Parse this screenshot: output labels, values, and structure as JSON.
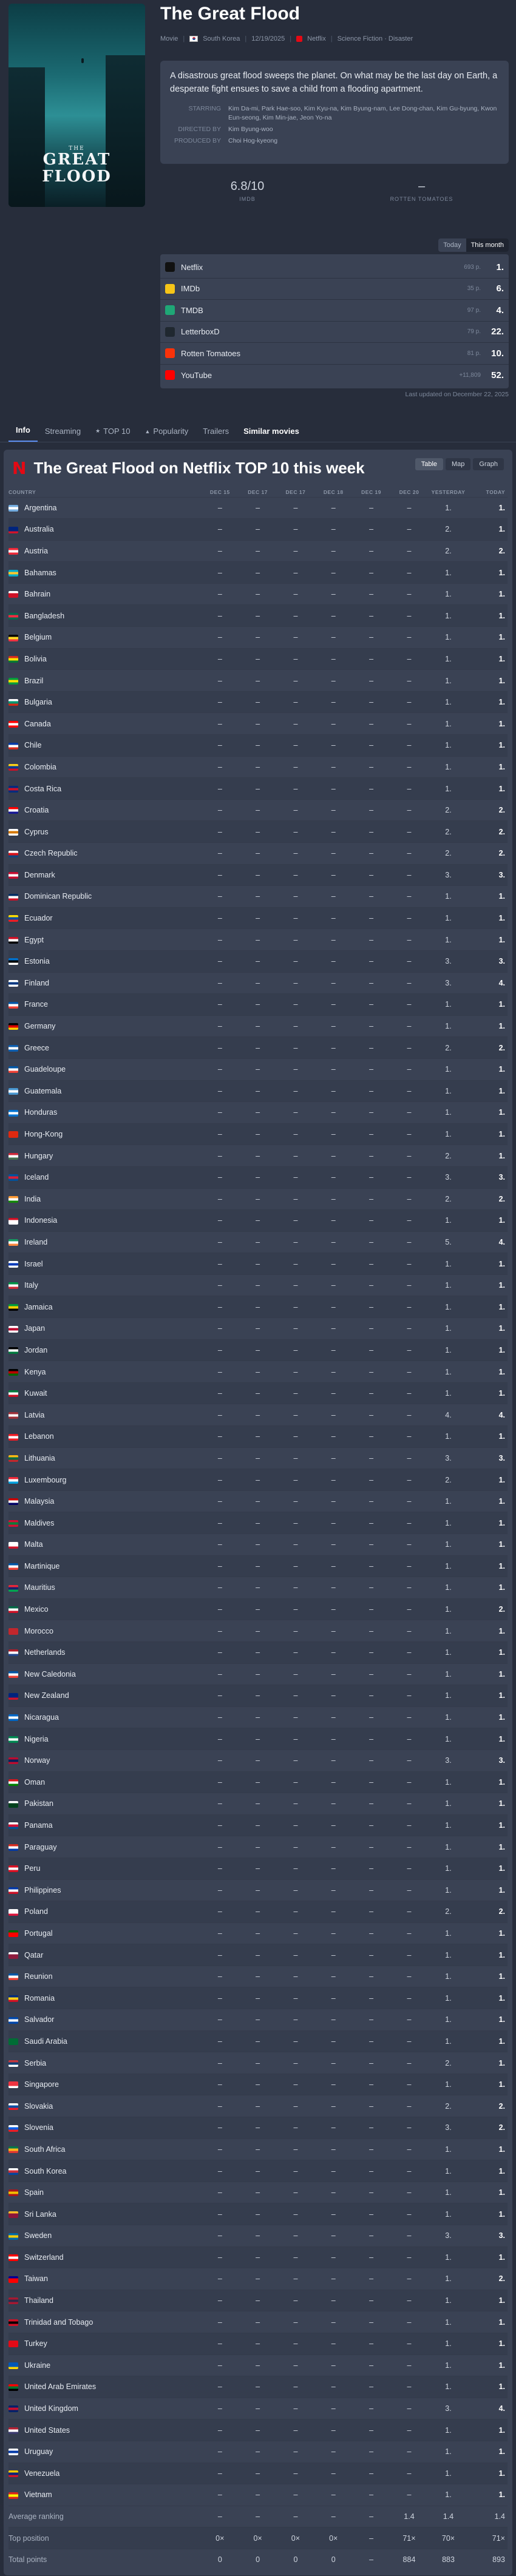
{
  "title": "The Great Flood",
  "meta": {
    "type": "Movie",
    "country": "South Korea",
    "date": "12/19/2025",
    "platform": "Netflix",
    "genres": "Science Fiction · Disaster"
  },
  "poster": {
    "title_line1": "THE",
    "title_line2": "GREAT FLOOD"
  },
  "description": "A disastrous great flood sweeps the planet. On what may be the last day on Earth, a desperate fight ensues to save a child from a flooding apartment.",
  "crew": [
    {
      "label": "STARRING",
      "value": "Kim Da-mi, Park Hae-soo, Kim Kyu-na, Kim Byung-nam, Lee Dong-chan, Kim Gu-byung, Kwon Eun-seong, Kim Min-jae, Jeon Yo-na"
    },
    {
      "label": "DIRECTED BY",
      "value": "Kim Byung-woo"
    },
    {
      "label": "PRODUCED BY",
      "value": "Choi Hog-kyeong"
    }
  ],
  "scores": [
    {
      "value": "6.8/10",
      "label": "IMDB"
    },
    {
      "value": "–",
      "label": "ROTTEN TOMATOES"
    }
  ],
  "period_toggle": {
    "today": "Today",
    "this_month": "This month"
  },
  "rankings": [
    {
      "name": "Netflix",
      "change": "693 p.",
      "position": "1.",
      "icon": "netflix-icon",
      "color": "#111111"
    },
    {
      "name": "IMDb",
      "change": "35 p.",
      "position": "6.",
      "icon": "imdb-icon",
      "color": "#f5c518"
    },
    {
      "name": "TMDB",
      "change": "97 p.",
      "position": "4.",
      "icon": "tmdb-icon",
      "color": "#1fa776"
    },
    {
      "name": "LetterboxD",
      "change": "79 p.",
      "position": "22.",
      "icon": "letterboxd-icon",
      "color": "#202830"
    },
    {
      "name": "Rotten Tomatoes",
      "change": "81 p.",
      "position": "10.",
      "icon": "tomato-icon",
      "color": "#fa320a"
    },
    {
      "name": "YouTube",
      "change": "+11,809",
      "position": "52.",
      "icon": "youtube-icon",
      "color": "#ff0000"
    }
  ],
  "last_updated": "Last updated on December 22, 2025",
  "tabs": [
    {
      "label": "Info",
      "active": true
    },
    {
      "label": "Streaming"
    },
    {
      "label": "TOP 10"
    },
    {
      "label": "Popularity"
    },
    {
      "label": "Trailers"
    },
    {
      "label": "Similar movies"
    }
  ],
  "section": {
    "title": "The Great Flood on Netflix TOP 10 this week",
    "views": [
      "Table",
      "Map",
      "Graph"
    ],
    "columns": [
      "COUNTRY",
      "DEC 15",
      "DEC 17",
      "DEC 17",
      "DEC 18",
      "DEC 19",
      "DEC 20",
      "YESTERDAY",
      "TODAY"
    ]
  },
  "countries": [
    {
      "name": "Argentina",
      "flag": [
        "#74acdf",
        "#ffffff",
        "#74acdf"
      ],
      "y": "1.",
      "t": "1."
    },
    {
      "name": "Australia",
      "flag": [
        "#00247d",
        "#00247d",
        "#cf142b"
      ],
      "y": "2.",
      "t": "1."
    },
    {
      "name": "Austria",
      "flag": [
        "#ed2939",
        "#ffffff",
        "#ed2939"
      ],
      "y": "2.",
      "t": "2."
    },
    {
      "name": "Bahamas",
      "flag": [
        "#00abc9",
        "#ffc72c",
        "#00abc9"
      ],
      "y": "1.",
      "t": "1."
    },
    {
      "name": "Bahrain",
      "flag": [
        "#ffffff",
        "#ce1126",
        "#ce1126"
      ],
      "y": "1.",
      "t": "1."
    },
    {
      "name": "Bangladesh",
      "flag": [
        "#006a4e",
        "#f42a41",
        "#006a4e"
      ],
      "y": "1.",
      "t": "1."
    },
    {
      "name": "Belgium",
      "flag": [
        "#000000",
        "#fdda24",
        "#ef3340"
      ],
      "y": "1.",
      "t": "1."
    },
    {
      "name": "Bolivia",
      "flag": [
        "#d52b1e",
        "#f9e300",
        "#007934"
      ],
      "y": "1.",
      "t": "1."
    },
    {
      "name": "Brazil",
      "flag": [
        "#009c3b",
        "#ffdf00",
        "#009c3b"
      ],
      "y": "1.",
      "t": "1."
    },
    {
      "name": "Bulgaria",
      "flag": [
        "#ffffff",
        "#00966e",
        "#d62612"
      ],
      "y": "1.",
      "t": "1."
    },
    {
      "name": "Canada",
      "flag": [
        "#ff0000",
        "#ffffff",
        "#ff0000"
      ],
      "y": "1.",
      "t": "1."
    },
    {
      "name": "Chile",
      "flag": [
        "#0039a6",
        "#ffffff",
        "#d52b1e"
      ],
      "y": "1.",
      "t": "1."
    },
    {
      "name": "Colombia",
      "flag": [
        "#fcd116",
        "#003893",
        "#ce1126"
      ],
      "y": "1.",
      "t": "1."
    },
    {
      "name": "Costa Rica",
      "flag": [
        "#002b7f",
        "#ce1126",
        "#002b7f"
      ],
      "y": "1.",
      "t": "1."
    },
    {
      "name": "Croatia",
      "flag": [
        "#ff0000",
        "#ffffff",
        "#171796"
      ],
      "y": "2.",
      "t": "2."
    },
    {
      "name": "Cyprus",
      "flag": [
        "#ffffff",
        "#d57800",
        "#ffffff"
      ],
      "y": "2.",
      "t": "2."
    },
    {
      "name": "Czech Republic",
      "flag": [
        "#ffffff",
        "#d7141a",
        "#11457e"
      ],
      "y": "2.",
      "t": "2."
    },
    {
      "name": "Denmark",
      "flag": [
        "#c60c30",
        "#ffffff",
        "#c60c30"
      ],
      "y": "3.",
      "t": "3."
    },
    {
      "name": "Dominican Republic",
      "flag": [
        "#002d62",
        "#ffffff",
        "#ce1126"
      ],
      "y": "1.",
      "t": "1."
    },
    {
      "name": "Ecuador",
      "flag": [
        "#ffdd00",
        "#034ea2",
        "#ed1c24"
      ],
      "y": "1.",
      "t": "1."
    },
    {
      "name": "Egypt",
      "flag": [
        "#ce1126",
        "#ffffff",
        "#000000"
      ],
      "y": "1.",
      "t": "1."
    },
    {
      "name": "Estonia",
      "flag": [
        "#0072ce",
        "#000000",
        "#ffffff"
      ],
      "y": "3.",
      "t": "3."
    },
    {
      "name": "Finland",
      "flag": [
        "#ffffff",
        "#003580",
        "#ffffff"
      ],
      "y": "3.",
      "t": "4."
    },
    {
      "name": "France",
      "flag": [
        "#0055a4",
        "#ffffff",
        "#ef4135"
      ],
      "y": "1.",
      "t": "1."
    },
    {
      "name": "Germany",
      "flag": [
        "#000000",
        "#dd0000",
        "#ffce00"
      ],
      "y": "1.",
      "t": "1."
    },
    {
      "name": "Greece",
      "flag": [
        "#0d5eaf",
        "#ffffff",
        "#0d5eaf"
      ],
      "y": "2.",
      "t": "2."
    },
    {
      "name": "Guadeloupe",
      "flag": [
        "#0055a4",
        "#ffffff",
        "#ef4135"
      ],
      "y": "1.",
      "t": "1."
    },
    {
      "name": "Guatemala",
      "flag": [
        "#4997d0",
        "#ffffff",
        "#4997d0"
      ],
      "y": "1.",
      "t": "1."
    },
    {
      "name": "Honduras",
      "flag": [
        "#0073cf",
        "#ffffff",
        "#0073cf"
      ],
      "y": "1.",
      "t": "1."
    },
    {
      "name": "Hong-Kong",
      "flag": [
        "#de2910",
        "#de2910",
        "#de2910"
      ],
      "y": "1.",
      "t": "1."
    },
    {
      "name": "Hungary",
      "flag": [
        "#ce2939",
        "#ffffff",
        "#477050"
      ],
      "y": "2.",
      "t": "1."
    },
    {
      "name": "Iceland",
      "flag": [
        "#02529c",
        "#dc1e35",
        "#02529c"
      ],
      "y": "3.",
      "t": "3."
    },
    {
      "name": "India",
      "flag": [
        "#ff9933",
        "#ffffff",
        "#138808"
      ],
      "y": "2.",
      "t": "2."
    },
    {
      "name": "Indonesia",
      "flag": [
        "#ce1126",
        "#ffffff",
        "#ffffff"
      ],
      "y": "1.",
      "t": "1."
    },
    {
      "name": "Ireland",
      "flag": [
        "#169b62",
        "#ffffff",
        "#ff883e"
      ],
      "y": "5.",
      "t": "4."
    },
    {
      "name": "Israel",
      "flag": [
        "#ffffff",
        "#0038b8",
        "#ffffff"
      ],
      "y": "1.",
      "t": "1."
    },
    {
      "name": "Italy",
      "flag": [
        "#009246",
        "#ffffff",
        "#ce2b37"
      ],
      "y": "1.",
      "t": "1."
    },
    {
      "name": "Jamaica",
      "flag": [
        "#009b3a",
        "#fed100",
        "#000000"
      ],
      "y": "1.",
      "t": "1."
    },
    {
      "name": "Japan",
      "flag": [
        "#ffffff",
        "#bc002d",
        "#ffffff"
      ],
      "y": "1.",
      "t": "1."
    },
    {
      "name": "Jordan",
      "flag": [
        "#000000",
        "#ffffff",
        "#007a3d"
      ],
      "y": "1.",
      "t": "1."
    },
    {
      "name": "Kenya",
      "flag": [
        "#000000",
        "#bb0000",
        "#006600"
      ],
      "y": "1.",
      "t": "1."
    },
    {
      "name": "Kuwait",
      "flag": [
        "#007a3d",
        "#ffffff",
        "#ce1126"
      ],
      "y": "1.",
      "t": "1."
    },
    {
      "name": "Latvia",
      "flag": [
        "#9e3039",
        "#ffffff",
        "#9e3039"
      ],
      "y": "4.",
      "t": "4."
    },
    {
      "name": "Lebanon",
      "flag": [
        "#ed1c24",
        "#ffffff",
        "#ed1c24"
      ],
      "y": "1.",
      "t": "1."
    },
    {
      "name": "Lithuania",
      "flag": [
        "#fdb913",
        "#006a44",
        "#c1272d"
      ],
      "y": "3.",
      "t": "3."
    },
    {
      "name": "Luxembourg",
      "flag": [
        "#ed2939",
        "#ffffff",
        "#00a1de"
      ],
      "y": "2.",
      "t": "1."
    },
    {
      "name": "Malaysia",
      "flag": [
        "#cc0001",
        "#ffffff",
        "#010066"
      ],
      "y": "1.",
      "t": "1."
    },
    {
      "name": "Maldives",
      "flag": [
        "#d21034",
        "#007e3a",
        "#d21034"
      ],
      "y": "1.",
      "t": "1."
    },
    {
      "name": "Malta",
      "flag": [
        "#ffffff",
        "#ffffff",
        "#cf142b"
      ],
      "y": "1.",
      "t": "1."
    },
    {
      "name": "Martinique",
      "flag": [
        "#0055a4",
        "#ffffff",
        "#ef4135"
      ],
      "y": "1.",
      "t": "1."
    },
    {
      "name": "Mauritius",
      "flag": [
        "#ea2839",
        "#1a206d",
        "#00a551"
      ],
      "y": "1.",
      "t": "1."
    },
    {
      "name": "Mexico",
      "flag": [
        "#006847",
        "#ffffff",
        "#ce1126"
      ],
      "y": "1.",
      "t": "2."
    },
    {
      "name": "Morocco",
      "flag": [
        "#c1272d",
        "#c1272d",
        "#c1272d"
      ],
      "y": "1.",
      "t": "1."
    },
    {
      "name": "Netherlands",
      "flag": [
        "#ae1c28",
        "#ffffff",
        "#21468b"
      ],
      "y": "1.",
      "t": "1."
    },
    {
      "name": "New Caledonia",
      "flag": [
        "#0055a4",
        "#ffffff",
        "#ef4135"
      ],
      "y": "1.",
      "t": "1."
    },
    {
      "name": "New Zealand",
      "flag": [
        "#00247d",
        "#00247d",
        "#cc142b"
      ],
      "y": "1.",
      "t": "1."
    },
    {
      "name": "Nicaragua",
      "flag": [
        "#0067c6",
        "#ffffff",
        "#0067c6"
      ],
      "y": "1.",
      "t": "1."
    },
    {
      "name": "Nigeria",
      "flag": [
        "#008751",
        "#ffffff",
        "#008751"
      ],
      "y": "1.",
      "t": "1."
    },
    {
      "name": "Norway",
      "flag": [
        "#ba0c2f",
        "#00205b",
        "#ba0c2f"
      ],
      "y": "3.",
      "t": "3."
    },
    {
      "name": "Oman",
      "flag": [
        "#db161b",
        "#ffffff",
        "#008000"
      ],
      "y": "1.",
      "t": "1."
    },
    {
      "name": "Pakistan",
      "flag": [
        "#ffffff",
        "#01411c",
        "#01411c"
      ],
      "y": "1.",
      "t": "1."
    },
    {
      "name": "Panama",
      "flag": [
        "#ffffff",
        "#d21034",
        "#005293"
      ],
      "y": "1.",
      "t": "1."
    },
    {
      "name": "Paraguay",
      "flag": [
        "#d52b1e",
        "#ffffff",
        "#0038a8"
      ],
      "y": "1.",
      "t": "1."
    },
    {
      "name": "Peru",
      "flag": [
        "#d91023",
        "#ffffff",
        "#d91023"
      ],
      "y": "1.",
      "t": "1."
    },
    {
      "name": "Philippines",
      "flag": [
        "#0038a8",
        "#ffffff",
        "#ce1126"
      ],
      "y": "1.",
      "t": "1."
    },
    {
      "name": "Poland",
      "flag": [
        "#ffffff",
        "#ffffff",
        "#dc143c"
      ],
      "y": "2.",
      "t": "2."
    },
    {
      "name": "Portugal",
      "flag": [
        "#006600",
        "#ff0000",
        "#ff0000"
      ],
      "y": "1.",
      "t": "1."
    },
    {
      "name": "Qatar",
      "flag": [
        "#ffffff",
        "#8d1b3d",
        "#8d1b3d"
      ],
      "y": "1.",
      "t": "1."
    },
    {
      "name": "Reunion",
      "flag": [
        "#0055a4",
        "#ffffff",
        "#ef4135"
      ],
      "y": "1.",
      "t": "1."
    },
    {
      "name": "Romania",
      "flag": [
        "#002b7f",
        "#fcd116",
        "#ce1126"
      ],
      "y": "1.",
      "t": "1."
    },
    {
      "name": "Salvador",
      "flag": [
        "#0047ab",
        "#ffffff",
        "#0047ab"
      ],
      "y": "1.",
      "t": "1."
    },
    {
      "name": "Saudi Arabia",
      "flag": [
        "#006c35",
        "#006c35",
        "#006c35"
      ],
      "y": "1.",
      "t": "1."
    },
    {
      "name": "Serbia",
      "flag": [
        "#c6363c",
        "#0c4076",
        "#ffffff"
      ],
      "y": "2.",
      "t": "1."
    },
    {
      "name": "Singapore",
      "flag": [
        "#ef3340",
        "#ef3340",
        "#ffffff"
      ],
      "y": "1.",
      "t": "1."
    },
    {
      "name": "Slovakia",
      "flag": [
        "#ffffff",
        "#0b4ea2",
        "#ee1c25"
      ],
      "y": "2.",
      "t": "2."
    },
    {
      "name": "Slovenia",
      "flag": [
        "#ffffff",
        "#005ce5",
        "#ed1c24"
      ],
      "y": "3.",
      "t": "2."
    },
    {
      "name": "South Africa",
      "flag": [
        "#007749",
        "#ffb81c",
        "#de3831"
      ],
      "y": "1.",
      "t": "1."
    },
    {
      "name": "South Korea",
      "flag": [
        "#ffffff",
        "#cd2e3a",
        "#0047a0"
      ],
      "y": "1.",
      "t": "1."
    },
    {
      "name": "Spain",
      "flag": [
        "#aa151b",
        "#f1bf00",
        "#aa151b"
      ],
      "y": "1.",
      "t": "1."
    },
    {
      "name": "Sri Lanka",
      "flag": [
        "#ffbe29",
        "#8d153a",
        "#8d153a"
      ],
      "y": "1.",
      "t": "1."
    },
    {
      "name": "Sweden",
      "flag": [
        "#006aa7",
        "#fecc00",
        "#006aa7"
      ],
      "y": "3.",
      "t": "3."
    },
    {
      "name": "Switzerland",
      "flag": [
        "#ff0000",
        "#ffffff",
        "#ff0000"
      ],
      "y": "1.",
      "t": "1."
    },
    {
      "name": "Taiwan",
      "flag": [
        "#000095",
        "#fe0000",
        "#fe0000"
      ],
      "y": "1.",
      "t": "2."
    },
    {
      "name": "Thailand",
      "flag": [
        "#a51931",
        "#2d2a4a",
        "#a51931"
      ],
      "y": "1.",
      "t": "1."
    },
    {
      "name": "Trinidad and Tobago",
      "flag": [
        "#ce1126",
        "#000000",
        "#ce1126"
      ],
      "y": "1.",
      "t": "1."
    },
    {
      "name": "Turkey",
      "flag": [
        "#e30a17",
        "#e30a17",
        "#e30a17"
      ],
      "y": "1.",
      "t": "1."
    },
    {
      "name": "Ukraine",
      "flag": [
        "#0057b7",
        "#0057b7",
        "#ffd700"
      ],
      "y": "1.",
      "t": "1."
    },
    {
      "name": "United Arab Emirates",
      "flag": [
        "#ff0000",
        "#00732f",
        "#000000"
      ],
      "y": "1.",
      "t": "1."
    },
    {
      "name": "United Kingdom",
      "flag": [
        "#012169",
        "#c8102e",
        "#012169"
      ],
      "y": "3.",
      "t": "4."
    },
    {
      "name": "United States",
      "flag": [
        "#b22234",
        "#ffffff",
        "#3c3b6e"
      ],
      "y": "1.",
      "t": "1."
    },
    {
      "name": "Uruguay",
      "flag": [
        "#ffffff",
        "#0038a8",
        "#ffffff"
      ],
      "y": "1.",
      "t": "1."
    },
    {
      "name": "Venezuela",
      "flag": [
        "#ffcc00",
        "#00247d",
        "#cf142b"
      ],
      "y": "1.",
      "t": "1."
    },
    {
      "name": "Vietnam",
      "flag": [
        "#da251d",
        "#ffff00",
        "#da251d"
      ],
      "y": "1.",
      "t": "1."
    }
  ],
  "footer_rows": [
    {
      "label": "Average ranking",
      "cells": [
        "–",
        "–",
        "–",
        "–",
        "–",
        "1.4",
        "1.4",
        "1.4"
      ]
    },
    {
      "label": "Top position",
      "cells": [
        "0×",
        "0×",
        "0×",
        "0×",
        "–",
        "71×",
        "70×",
        "71×"
      ]
    },
    {
      "label": "Total points",
      "cells": [
        "0",
        "0",
        "0",
        "0",
        "–",
        "884",
        "883",
        "893"
      ]
    }
  ]
}
